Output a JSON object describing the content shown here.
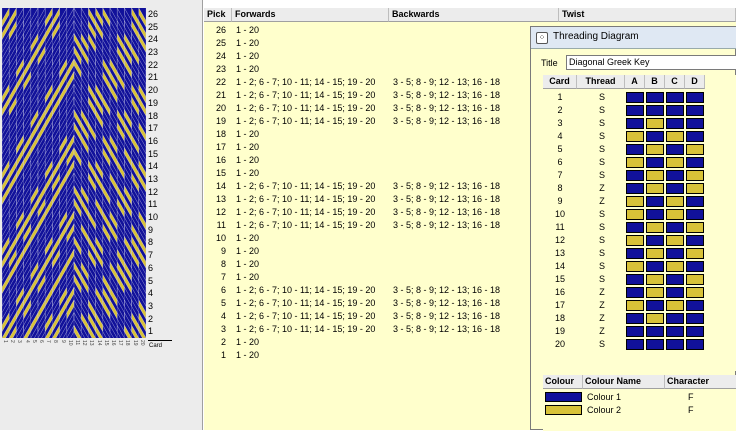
{
  "pattern": {
    "card_count": 20,
    "pick_count": 26,
    "colors": {
      "colour1": "#11119a",
      "colour2": "#d8c238"
    },
    "picks_top_to_bottom": [
      "26",
      "25",
      "24",
      "23",
      "22",
      "21",
      "20",
      "19",
      "18",
      "17",
      "16",
      "15",
      "14",
      "13",
      "12",
      "11",
      "10",
      "9",
      "8",
      "7",
      "6",
      "5",
      "4",
      "3",
      "2",
      "1"
    ],
    "card_axis_label": "Card"
  },
  "table": {
    "headers": {
      "pick": "Pick",
      "forwards": "Forwards",
      "backwards": "Backwards",
      "twist": "Twist"
    },
    "rows": [
      {
        "pick": "26",
        "fwd": "1 - 20",
        "bwd": ""
      },
      {
        "pick": "25",
        "fwd": "1 - 20",
        "bwd": ""
      },
      {
        "pick": "24",
        "fwd": "1 - 20",
        "bwd": ""
      },
      {
        "pick": "23",
        "fwd": "1 - 20",
        "bwd": ""
      },
      {
        "pick": "22",
        "fwd": "1 - 2; 6 - 7; 10 - 11; 14 - 15; 19 - 20",
        "bwd": "3 - 5; 8 - 9; 12 - 13; 16 - 18"
      },
      {
        "pick": "21",
        "fwd": "1 - 2; 6 - 7; 10 - 11; 14 - 15; 19 - 20",
        "bwd": "3 - 5; 8 - 9; 12 - 13; 16 - 18"
      },
      {
        "pick": "20",
        "fwd": "1 - 2; 6 - 7; 10 - 11; 14 - 15; 19 - 20",
        "bwd": "3 - 5; 8 - 9; 12 - 13; 16 - 18"
      },
      {
        "pick": "19",
        "fwd": "1 - 2; 6 - 7; 10 - 11; 14 - 15; 19 - 20",
        "bwd": "3 - 5; 8 - 9; 12 - 13; 16 - 18"
      },
      {
        "pick": "18",
        "fwd": "1 - 20",
        "bwd": ""
      },
      {
        "pick": "17",
        "fwd": "1 - 20",
        "bwd": ""
      },
      {
        "pick": "16",
        "fwd": "1 - 20",
        "bwd": ""
      },
      {
        "pick": "15",
        "fwd": "1 - 20",
        "bwd": ""
      },
      {
        "pick": "14",
        "fwd": "1 - 2; 6 - 7; 10 - 11; 14 - 15; 19 - 20",
        "bwd": "3 - 5; 8 - 9; 12 - 13; 16 - 18"
      },
      {
        "pick": "13",
        "fwd": "1 - 2; 6 - 7; 10 - 11; 14 - 15; 19 - 20",
        "bwd": "3 - 5; 8 - 9; 12 - 13; 16 - 18"
      },
      {
        "pick": "12",
        "fwd": "1 - 2; 6 - 7; 10 - 11; 14 - 15; 19 - 20",
        "bwd": "3 - 5; 8 - 9; 12 - 13; 16 - 18"
      },
      {
        "pick": "11",
        "fwd": "1 - 2; 6 - 7; 10 - 11; 14 - 15; 19 - 20",
        "bwd": "3 - 5; 8 - 9; 12 - 13; 16 - 18"
      },
      {
        "pick": "10",
        "fwd": "1 - 20",
        "bwd": ""
      },
      {
        "pick": "9",
        "fwd": "1 - 20",
        "bwd": ""
      },
      {
        "pick": "8",
        "fwd": "1 - 20",
        "bwd": ""
      },
      {
        "pick": "7",
        "fwd": "1 - 20",
        "bwd": ""
      },
      {
        "pick": "6",
        "fwd": "1 - 2; 6 - 7; 10 - 11; 14 - 15; 19 - 20",
        "bwd": "3 - 5; 8 - 9; 12 - 13; 16 - 18"
      },
      {
        "pick": "5",
        "fwd": "1 - 2; 6 - 7; 10 - 11; 14 - 15; 19 - 20",
        "bwd": "3 - 5; 8 - 9; 12 - 13; 16 - 18"
      },
      {
        "pick": "4",
        "fwd": "1 - 2; 6 - 7; 10 - 11; 14 - 15; 19 - 20",
        "bwd": "3 - 5; 8 - 9; 12 - 13; 16 - 18"
      },
      {
        "pick": "3",
        "fwd": "1 - 2; 6 - 7; 10 - 11; 14 - 15; 19 - 20",
        "bwd": "3 - 5; 8 - 9; 12 - 13; 16 - 18"
      },
      {
        "pick": "2",
        "fwd": "1 - 20",
        "bwd": ""
      },
      {
        "pick": "1",
        "fwd": "1 - 20",
        "bwd": ""
      }
    ]
  },
  "threading_window": {
    "title": "Threading Diagram",
    "title_label": "Title",
    "title_value": "Diagonal Greek Key",
    "headers": {
      "card": "Card",
      "thread": "Thread",
      "a": "A",
      "b": "B",
      "c": "C",
      "d": "D"
    },
    "cards": [
      {
        "card": "1",
        "thread": "S",
        "holes": [
          1,
          1,
          1,
          1
        ]
      },
      {
        "card": "2",
        "thread": "S",
        "holes": [
          1,
          1,
          1,
          1
        ]
      },
      {
        "card": "3",
        "thread": "S",
        "holes": [
          1,
          2,
          1,
          1
        ]
      },
      {
        "card": "4",
        "thread": "S",
        "holes": [
          2,
          1,
          2,
          1
        ]
      },
      {
        "card": "5",
        "thread": "S",
        "holes": [
          1,
          2,
          1,
          2
        ]
      },
      {
        "card": "6",
        "thread": "S",
        "holes": [
          2,
          1,
          2,
          1
        ]
      },
      {
        "card": "7",
        "thread": "S",
        "holes": [
          1,
          2,
          1,
          2
        ]
      },
      {
        "card": "8",
        "thread": "Z",
        "holes": [
          1,
          2,
          1,
          2
        ]
      },
      {
        "card": "9",
        "thread": "Z",
        "holes": [
          2,
          1,
          2,
          1
        ]
      },
      {
        "card": "10",
        "thread": "S",
        "holes": [
          2,
          1,
          2,
          1
        ]
      },
      {
        "card": "11",
        "thread": "S",
        "holes": [
          1,
          2,
          1,
          2
        ]
      },
      {
        "card": "12",
        "thread": "S",
        "holes": [
          2,
          1,
          2,
          1
        ]
      },
      {
        "card": "13",
        "thread": "S",
        "holes": [
          1,
          2,
          1,
          2
        ]
      },
      {
        "card": "14",
        "thread": "S",
        "holes": [
          2,
          1,
          2,
          1
        ]
      },
      {
        "card": "15",
        "thread": "S",
        "holes": [
          1,
          2,
          1,
          2
        ]
      },
      {
        "card": "16",
        "thread": "Z",
        "holes": [
          1,
          2,
          1,
          2
        ]
      },
      {
        "card": "17",
        "thread": "Z",
        "holes": [
          2,
          1,
          2,
          1
        ]
      },
      {
        "card": "18",
        "thread": "Z",
        "holes": [
          1,
          2,
          1,
          1
        ]
      },
      {
        "card": "19",
        "thread": "Z",
        "holes": [
          1,
          1,
          1,
          1
        ]
      },
      {
        "card": "20",
        "thread": "S",
        "holes": [
          1,
          1,
          1,
          1
        ]
      }
    ],
    "colour_table": {
      "headers": {
        "colour": "Colour",
        "name": "Colour Name",
        "character": "Character"
      },
      "rows": [
        {
          "swatch": "#11119a",
          "name": "Colour 1",
          "character": "F"
        },
        {
          "swatch": "#d8c238",
          "name": "Colour 2",
          "character": "F"
        }
      ]
    }
  }
}
